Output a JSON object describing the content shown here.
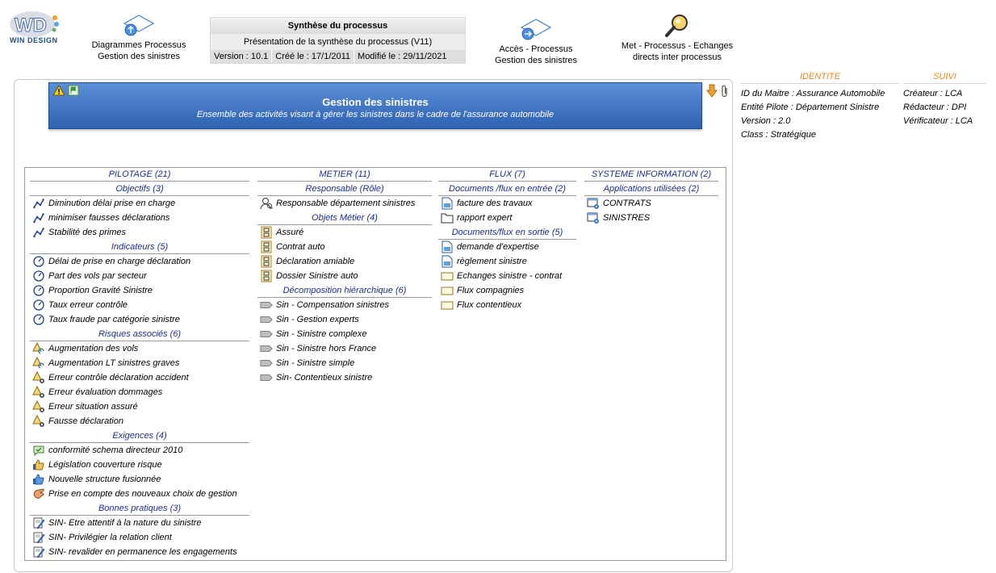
{
  "header": {
    "logo_text": "WIN DESIGN",
    "nav_diagrams": {
      "line1": "Diagrammes Processus",
      "line2": "Gestion des sinistres"
    },
    "synthese": {
      "title": "Synthèse du processus",
      "subtitle": "Présentation de la synthèse du processus (V11)",
      "version": "Version : 10.1",
      "created": "Créé le : 17/1/2011",
      "modified": "Modifié le : 29/11/2021"
    },
    "nav_acces": {
      "line1": "Accès - Processus",
      "line2": "Gestion des sinistres"
    },
    "nav_met": {
      "line1": "Met - Processus - Echanges",
      "line2": "directs inter processus"
    }
  },
  "identite": {
    "title": "IDENTITE",
    "lines": [
      "ID du Maitre : Assurance Automobile",
      "Entité Pilote : Département Sinistre",
      "Version : 2.0",
      "Class : Stratégique"
    ]
  },
  "suivi": {
    "title": "SUIVI",
    "lines": [
      "Créateur : LCA",
      "Rédacteur : DPI",
      "Vérificateur : LCA"
    ]
  },
  "banner": {
    "title": "Gestion des sinistres",
    "subtitle": "Ensemble des activités visant à gérer les sinistres dans le cadre de l'assurance automobile"
  },
  "columns": {
    "pilotage": {
      "title": "PILOTAGE (21)",
      "objectifs": {
        "title": "Objectifs (3)",
        "items": [
          "Diminution délai prise en charge",
          "minimiser fausses déclarations",
          "Stabilité des primes"
        ]
      },
      "indicateurs": {
        "title": "Indicateurs (5)",
        "items": [
          "Délai de prise en charge déclaration",
          "Part des vols par secteur",
          "Proportion Gravité Sinistre",
          "Taux erreur contrôle",
          "Taux fraude par catégorie sinistre"
        ]
      },
      "risques": {
        "title": "Risques associés (6)",
        "items": [
          "Augmentation des vols",
          "Augmentation LT sinistres graves",
          "Erreur contrôle déclaration accident",
          "Erreur évaluation dommages",
          "Erreur situation assuré",
          "Fausse déclaration"
        ]
      },
      "exigences": {
        "title": "Exigences (4)",
        "items": [
          "conformité schema directeur 2010",
          "Législation couverture risque",
          "Nouvelle structure fusionnée",
          "Prise en compte des nouveaux choix de gestion"
        ]
      },
      "pratiques": {
        "title": "Bonnes pratiques (3)",
        "items": [
          "SIN- Etre attentif à la nature du sinistre",
          "SIN- Privilégier la relation client",
          "SIN- revalider en permanence les engagements"
        ]
      }
    },
    "metier": {
      "title": "METIER (11)",
      "responsable": {
        "title": "Responsable (Rôle)",
        "items": [
          "Responsable département sinistres"
        ]
      },
      "objets": {
        "title": "Objets Métier (4)",
        "items": [
          "Assuré",
          "Contrat auto",
          "Déclaration amiable",
          "Dossier Sinistre auto"
        ]
      },
      "decomposition": {
        "title": "Décomposition hiérarchique (6)",
        "items": [
          "Sin - Compensation sinistres",
          "Sin - Gestion experts",
          "Sin - Sinistre complexe",
          "Sin - Sinistre hors France",
          "Sin - Sinistre simple",
          "Sin- Contentieux sinistre"
        ]
      }
    },
    "flux": {
      "title": "FLUX (7)",
      "entree": {
        "title": "Documents /flux en entrée (2)",
        "items": [
          "facture des travaux",
          "rapport expert"
        ]
      },
      "sortie": {
        "title": "Documents/flux en sortie (5)",
        "items": [
          "demande d'expertise",
          "règlement sinistre",
          "Echanges sinistre - contrat",
          "Flux compagnies",
          "Flux contentieux"
        ]
      }
    },
    "si": {
      "title": "SYSTEME INFORMATION (2)",
      "applications": {
        "title": "Applications utilisées (2)",
        "items": [
          "CONTRATS",
          "SINISTRES"
        ]
      }
    }
  }
}
